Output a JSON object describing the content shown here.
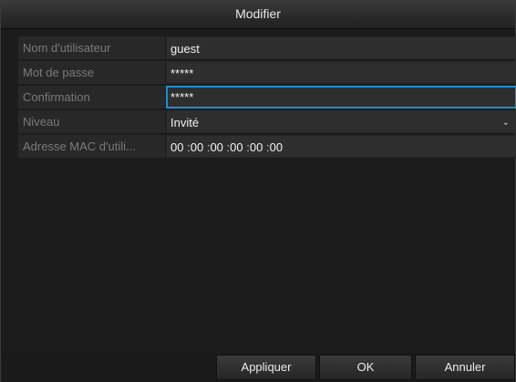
{
  "dialog": {
    "title": "Modifier"
  },
  "form": {
    "username_label": "Nom d'utilisateur",
    "username_value": "guest",
    "password_label": "Mot de passe",
    "password_value": "*****",
    "confirm_label": "Confirmation",
    "confirm_value": "*****",
    "level_label": "Niveau",
    "level_value": "Invité",
    "mac_label": "Adresse MAC d'utili...",
    "mac_octets": [
      "00",
      "00",
      "00",
      "00",
      "00",
      "00"
    ],
    "mac_separator": ":"
  },
  "buttons": {
    "apply": "Appliquer",
    "ok": "OK",
    "cancel": "Annuler"
  },
  "icons": {
    "level_dropdown": "chevron-down-icon"
  },
  "colors": {
    "focus_border": "#1e8fd0",
    "background": "#1c1c1c"
  }
}
